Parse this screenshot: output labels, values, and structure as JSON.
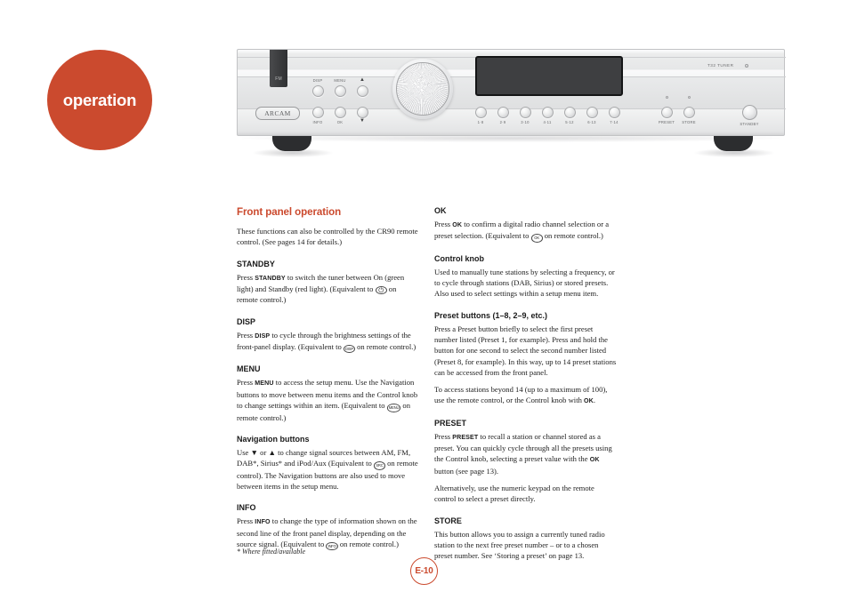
{
  "section": {
    "bubble_label": "operation",
    "accent_color": "#cb4a2e"
  },
  "product_image": {
    "brand_logo": "ARCAM",
    "model_label": "T32 TUNER",
    "source_tab_label": "FM",
    "top_row_buttons": [
      {
        "label": "DISP"
      },
      {
        "label": "MENU"
      },
      {
        "label": "▲"
      }
    ],
    "bottom_row_buttons": [
      {
        "label": "INFO"
      },
      {
        "label": "OK"
      },
      {
        "label": "▼"
      }
    ],
    "preset_buttons": [
      {
        "label": "1·8"
      },
      {
        "label": "2·9"
      },
      {
        "label": "3·10"
      },
      {
        "label": "4·11"
      },
      {
        "label": "5·12"
      },
      {
        "label": "6·13"
      },
      {
        "label": "7·14"
      }
    ],
    "function_buttons": [
      {
        "label": "PRESET"
      },
      {
        "label": "STORE"
      }
    ],
    "standby_label": "STANDBY"
  },
  "left_column": {
    "title": "Front panel operation",
    "intro": "These functions can also be controlled by the CR90 remote control. (See pages 14 for details.)",
    "sections": [
      {
        "heading": "STANDBY",
        "paragraphs": [
          {
            "parts": [
              {
                "type": "text",
                "text": "Press "
              },
              {
                "type": "kw",
                "text": "STANDBY"
              },
              {
                "type": "text",
                "text": " to switch the tuner between On (green light) and Standby (red light). (Equivalent to "
              },
              {
                "type": "rc",
                "text": "⏻",
                "glyph": true
              },
              {
                "type": "text",
                "text": " on remote control.)"
              }
            ]
          }
        ]
      },
      {
        "heading": "DISP",
        "paragraphs": [
          {
            "parts": [
              {
                "type": "text",
                "text": "Press "
              },
              {
                "type": "kw",
                "text": "DISP"
              },
              {
                "type": "text",
                "text": " to cycle through the brightness settings of the front-panel display. (Equivalent to "
              },
              {
                "type": "rc",
                "text": "DISP"
              },
              {
                "type": "text",
                "text": " on remote control.)"
              }
            ]
          }
        ]
      },
      {
        "heading": "MENU",
        "paragraphs": [
          {
            "parts": [
              {
                "type": "text",
                "text": "Press "
              },
              {
                "type": "kw",
                "text": "MENU"
              },
              {
                "type": "text",
                "text": " to access the setup menu. Use the Navigation buttons to move between menu items and the Control knob to change settings within an item. (Equivalent to "
              },
              {
                "type": "rc",
                "text": "MENU"
              },
              {
                "type": "text",
                "text": " on remote control.)"
              }
            ]
          }
        ]
      },
      {
        "heading": "Navigation buttons",
        "paragraphs": [
          {
            "parts": [
              {
                "type": "text",
                "text": "Use "
              },
              {
                "type": "text",
                "text": "▼"
              },
              {
                "type": "text",
                "text": " or  "
              },
              {
                "type": "text",
                "text": "▲"
              },
              {
                "type": "text",
                "text": " to change signal sources between AM, FM, DAB*, Sirius* and iPod/Aux (Equivalent to "
              },
              {
                "type": "rc",
                "text": "SRC"
              },
              {
                "type": "text",
                "text": " on remote control). The Navigation buttons are also used to move between items in the setup menu."
              }
            ]
          }
        ]
      },
      {
        "heading": "INFO",
        "paragraphs": [
          {
            "parts": [
              {
                "type": "text",
                "text": "Press "
              },
              {
                "type": "kw",
                "text": "INFO"
              },
              {
                "type": "text",
                "text": " to change the type of information shown on the second line of the front panel display, depending on the source signal. (Equivalent to "
              },
              {
                "type": "rc",
                "text": "INFO"
              },
              {
                "type": "text",
                "text": " on remote control.)"
              }
            ]
          }
        ]
      }
    ]
  },
  "right_column": {
    "sections": [
      {
        "heading": "OK",
        "paragraphs": [
          {
            "parts": [
              {
                "type": "text",
                "text": "Press "
              },
              {
                "type": "kw",
                "text": "OK"
              },
              {
                "type": "text",
                "text": " to confirm a digital radio channel selection or a preset selection. (Equivalent to "
              },
              {
                "type": "rc",
                "text": "OK"
              },
              {
                "type": "text",
                "text": " on remote control.)"
              }
            ]
          }
        ]
      },
      {
        "heading": "Control knob",
        "paragraphs": [
          {
            "parts": [
              {
                "type": "text",
                "text": "Used to manually tune stations by selecting a frequency, or to cycle through stations (DAB, Sirius) or stored presets. Also used  to select settings within a setup menu item."
              }
            ]
          }
        ]
      },
      {
        "heading": "Preset buttons (1–8, 2–9, etc.)",
        "paragraphs": [
          {
            "parts": [
              {
                "type": "text",
                "text": "Press a Preset button briefly to select the first preset number listed (Preset 1, for example). Press and hold the button for one second to select the second number listed (Preset 8, for example). In this way, up to 14 preset stations can be accessed from the front panel."
              }
            ]
          },
          {
            "parts": [
              {
                "type": "text",
                "text": "To access stations beyond 14 (up to a maximum of 100), use the remote control, or the Control knob with "
              },
              {
                "type": "kw",
                "text": "OK"
              },
              {
                "type": "text",
                "text": "."
              }
            ]
          }
        ]
      },
      {
        "heading": "PRESET",
        "paragraphs": [
          {
            "parts": [
              {
                "type": "text",
                "text": "Press "
              },
              {
                "type": "kw",
                "text": "PRESET"
              },
              {
                "type": "text",
                "text": " to recall a station or channel stored as a preset. You can quickly cycle through all the presets using the Control knob, selecting a preset value with the "
              },
              {
                "type": "kw",
                "text": "OK"
              },
              {
                "type": "text",
                "text": " button (see page 13)."
              }
            ]
          },
          {
            "parts": [
              {
                "type": "text",
                "text": "Alternatively, use the numeric keypad on the remote control to select a preset directly."
              }
            ]
          }
        ]
      },
      {
        "heading": "STORE",
        "paragraphs": [
          {
            "parts": [
              {
                "type": "text",
                "text": "This button allows you to assign a currently tuned radio station to the next free preset number – or to a chosen preset number. See ‘Storing a preset’ on page 13."
              }
            ]
          }
        ]
      }
    ]
  },
  "footer": {
    "footnote": "* Where fitted/available",
    "page_number": "E-10"
  }
}
